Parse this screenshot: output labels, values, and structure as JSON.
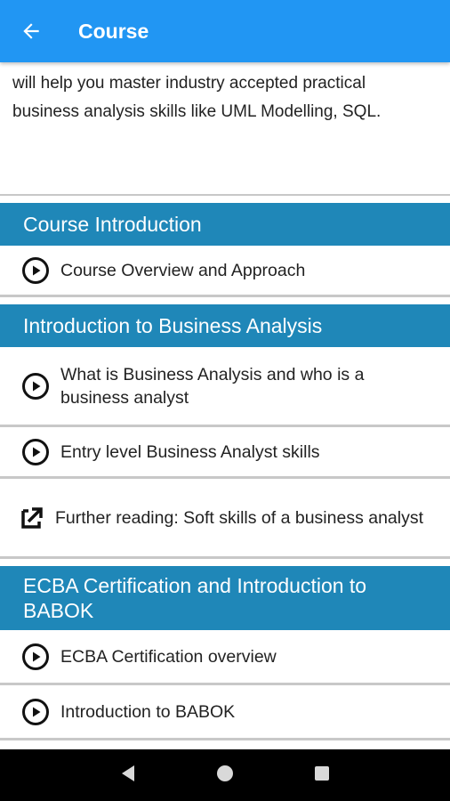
{
  "appbar": {
    "title": "Course",
    "back_icon": "arrow-left-icon"
  },
  "description": {
    "cut_line": "...                                              ...",
    "line1": "will help you master industry accepted practical",
    "line2": "business analysis skills like UML Modelling, SQL."
  },
  "sections": [
    {
      "title": "Course Introduction",
      "items": [
        {
          "label": "Course Overview and Approach",
          "icon": "play-circle-icon"
        }
      ]
    },
    {
      "title": "Introduction to Business Analysis",
      "items": [
        {
          "label": "What is Business Analysis and who is a business analyst",
          "icon": "play-circle-icon"
        },
        {
          "label": "Entry level Business Analyst skills",
          "icon": "play-circle-icon"
        },
        {
          "label": "Further reading: Soft skills of a business analyst",
          "icon": "external-link-icon"
        }
      ]
    },
    {
      "title": "ECBA Certification and Introduction to BABOK",
      "items": [
        {
          "label": "ECBA Certification overview",
          "icon": "play-circle-icon"
        },
        {
          "label": "Introduction to BABOK",
          "icon": "play-circle-icon"
        }
      ]
    }
  ],
  "navbar": {
    "back": "nav-back-icon",
    "home": "nav-home-icon",
    "recents": "nav-recents-icon"
  },
  "colors": {
    "appbar": "#2196f3",
    "section_header": "#1f87b8",
    "navbar": "#000000"
  }
}
